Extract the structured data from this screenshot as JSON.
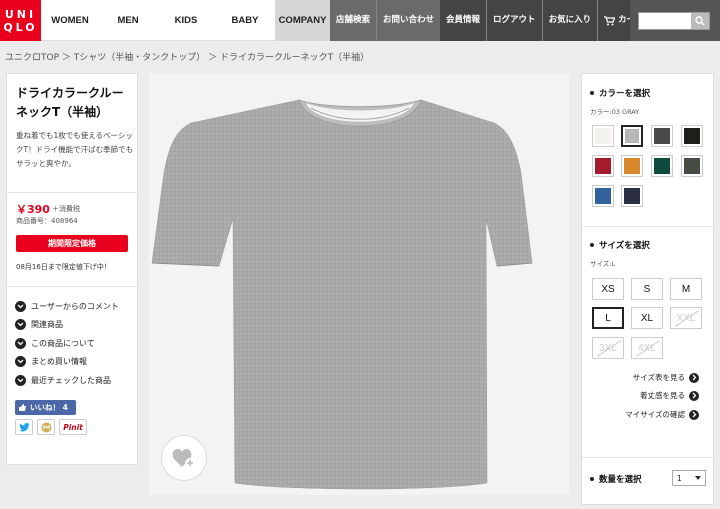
{
  "logo": {
    "line1": "UNI",
    "line2": "QLO"
  },
  "nav": {
    "main": [
      "WOMEN",
      "MEN",
      "KIDS",
      "BABY",
      "COMPANY"
    ],
    "utility": [
      "店舗検索",
      "お問い合わせ",
      "会員情報",
      "ログアウト",
      "お気に入り",
      "カート"
    ]
  },
  "breadcrumb": "ユニクロTOP ＞ Tシャツ（半袖・タンクトップ） ＞ ドライカラークルーネックT（半袖）",
  "product": {
    "title": "ドライカラークルーネックT（半袖）",
    "description": "重ね着でも1枚でも使えるベーシックT！ドライ機能で汗ばむ季節でもサラッと爽やか。",
    "price": "￥390",
    "tax": "＋消費税",
    "number": "商品番号：408964",
    "promo_label": "期間限定価格",
    "promo_note": "08月16日まで限定値下げ中！"
  },
  "links": [
    "ユーザーからのコメント",
    "関連商品",
    "この商品について",
    "まとめ買い情報",
    "最近チェックした商品"
  ],
  "social": {
    "like_label": "いいね！ 4",
    "pinit": "Pinit"
  },
  "color": {
    "heading": "カラーを選択",
    "selected": "カラー:03 GRAY",
    "swatches": [
      "#f2f1ee",
      "#b7b7b7",
      "#4a4a4a",
      "#1e1f1b",
      "#a51a2d",
      "#d9892d",
      "#0f4a3e",
      "#474c44",
      "#32629b",
      "#2a2f45"
    ]
  },
  "size": {
    "heading": "サイズを選択",
    "selected": "サイズ:L",
    "options": [
      "XS",
      "S",
      "M",
      "L",
      "XL",
      "XXL",
      "3XL",
      "4XL"
    ],
    "links": [
      "サイズ表を見る",
      "着丈感を見る",
      "マイサイズの確認"
    ]
  },
  "quantity": {
    "heading": "数量を選択",
    "value": "1"
  },
  "colors": {
    "brand_red": "#e8001c",
    "nav_gray": "#6a6a6a"
  }
}
